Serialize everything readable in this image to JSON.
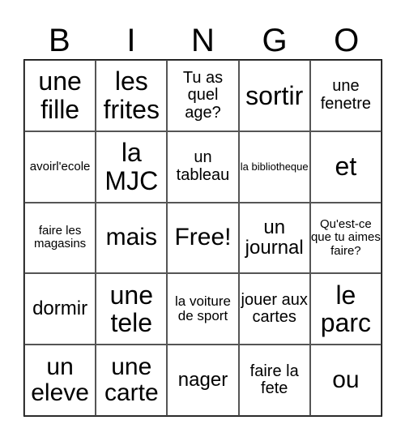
{
  "header": [
    "B",
    "I",
    "N",
    "G",
    "O"
  ],
  "cells": [
    [
      "une fille",
      "les frites",
      "Tu as quel age?",
      "sortir",
      "une fenetre"
    ],
    [
      "avoirl'ecole",
      "la MJC",
      "un tableau",
      "la bibliotheque",
      "et"
    ],
    [
      "faire les magasins",
      "mais",
      "Free!",
      "un journal",
      "Qu'est-ce que tu aimes faire?"
    ],
    [
      "dormir",
      "une tele",
      "la voiture de sport",
      "jouer aux cartes",
      "le parc"
    ],
    [
      "un eleve",
      "une carte",
      "nager",
      "faire la fete",
      "ou"
    ]
  ]
}
